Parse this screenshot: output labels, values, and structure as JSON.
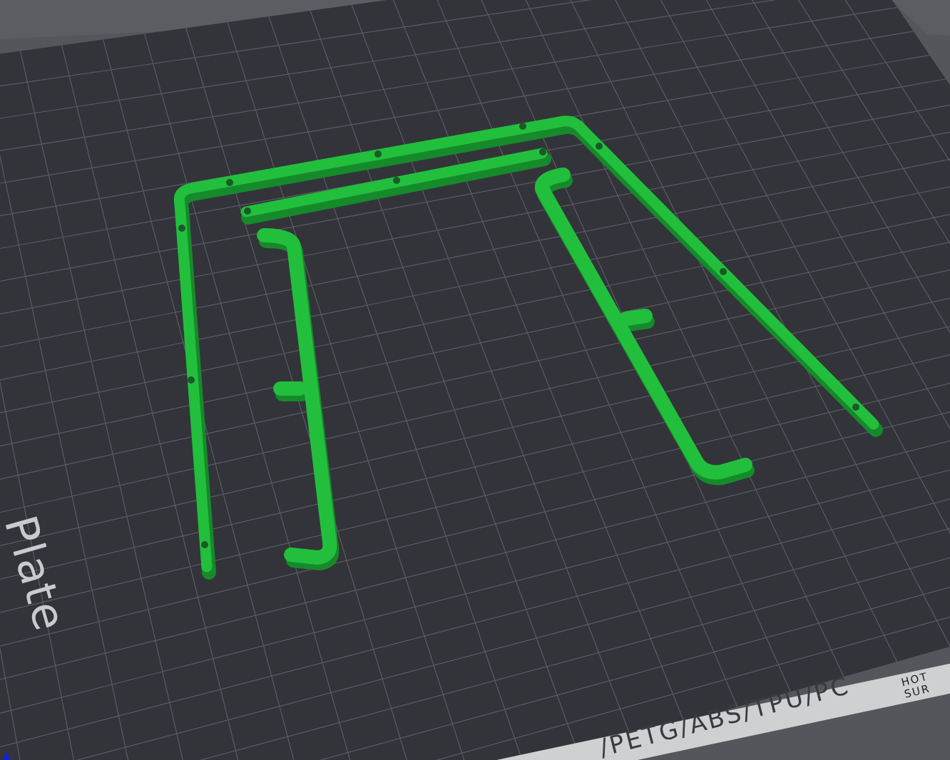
{
  "viewport": {
    "plate_label": "Plate",
    "filament_strip": "/PETG/ABS/TPU/PC",
    "warning_lines": [
      "HOT",
      "SUR"
    ]
  }
}
